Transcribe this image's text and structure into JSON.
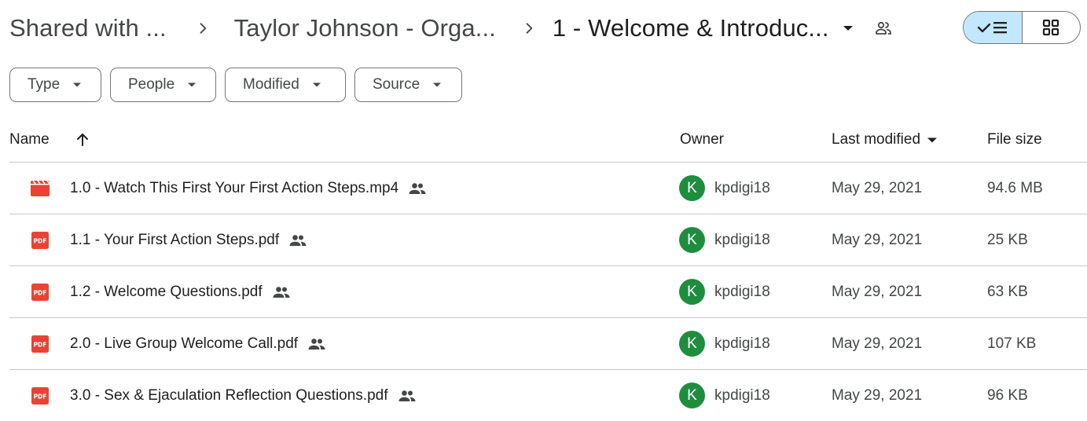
{
  "breadcrumb": {
    "items": [
      {
        "label": "Shared with ..."
      },
      {
        "label": "Taylor Johnson - Orga..."
      },
      {
        "label": "1 - Welcome & Introduc..."
      }
    ]
  },
  "icons": {
    "separator": "chevron-right-icon",
    "dropdown": "caret-down-icon",
    "shared": "people-icon",
    "list_view": "check-list-view-icon",
    "grid_view": "grid-view-icon"
  },
  "filters": [
    {
      "label": "Type"
    },
    {
      "label": "People"
    },
    {
      "label": "Modified"
    },
    {
      "label": "Source"
    }
  ],
  "table": {
    "headers": {
      "name": "Name",
      "owner": "Owner",
      "last_modified": "Last modified",
      "file_size": "File size"
    },
    "rows": [
      {
        "name": "1.0 - Watch This First Your First Action Steps.mp4",
        "type": "video",
        "owner_initial": "K",
        "owner": "kpdigi18",
        "modified": "May 29, 2021",
        "size": "94.6 MB"
      },
      {
        "name": "1.1 - Your First Action Steps.pdf",
        "type": "pdf",
        "owner_initial": "K",
        "owner": "kpdigi18",
        "modified": "May 29, 2021",
        "size": "25 KB"
      },
      {
        "name": "1.2 - Welcome Questions.pdf",
        "type": "pdf",
        "owner_initial": "K",
        "owner": "kpdigi18",
        "modified": "May 29, 2021",
        "size": "63 KB"
      },
      {
        "name": "2.0 - Live Group Welcome Call.pdf",
        "type": "pdf",
        "owner_initial": "K",
        "owner": "kpdigi18",
        "modified": "May 29, 2021",
        "size": "107 KB"
      },
      {
        "name": "3.0 - Sex & Ejaculation Reflection Questions.pdf",
        "type": "pdf",
        "owner_initial": "K",
        "owner": "kpdigi18",
        "modified": "May 29, 2021",
        "size": "96 KB"
      }
    ]
  },
  "colors": {
    "pdf_red": "#ea4335",
    "video_red": "#ea4335",
    "avatar_green": "#1e8e3e",
    "toggle_active": "#c2e7ff"
  }
}
